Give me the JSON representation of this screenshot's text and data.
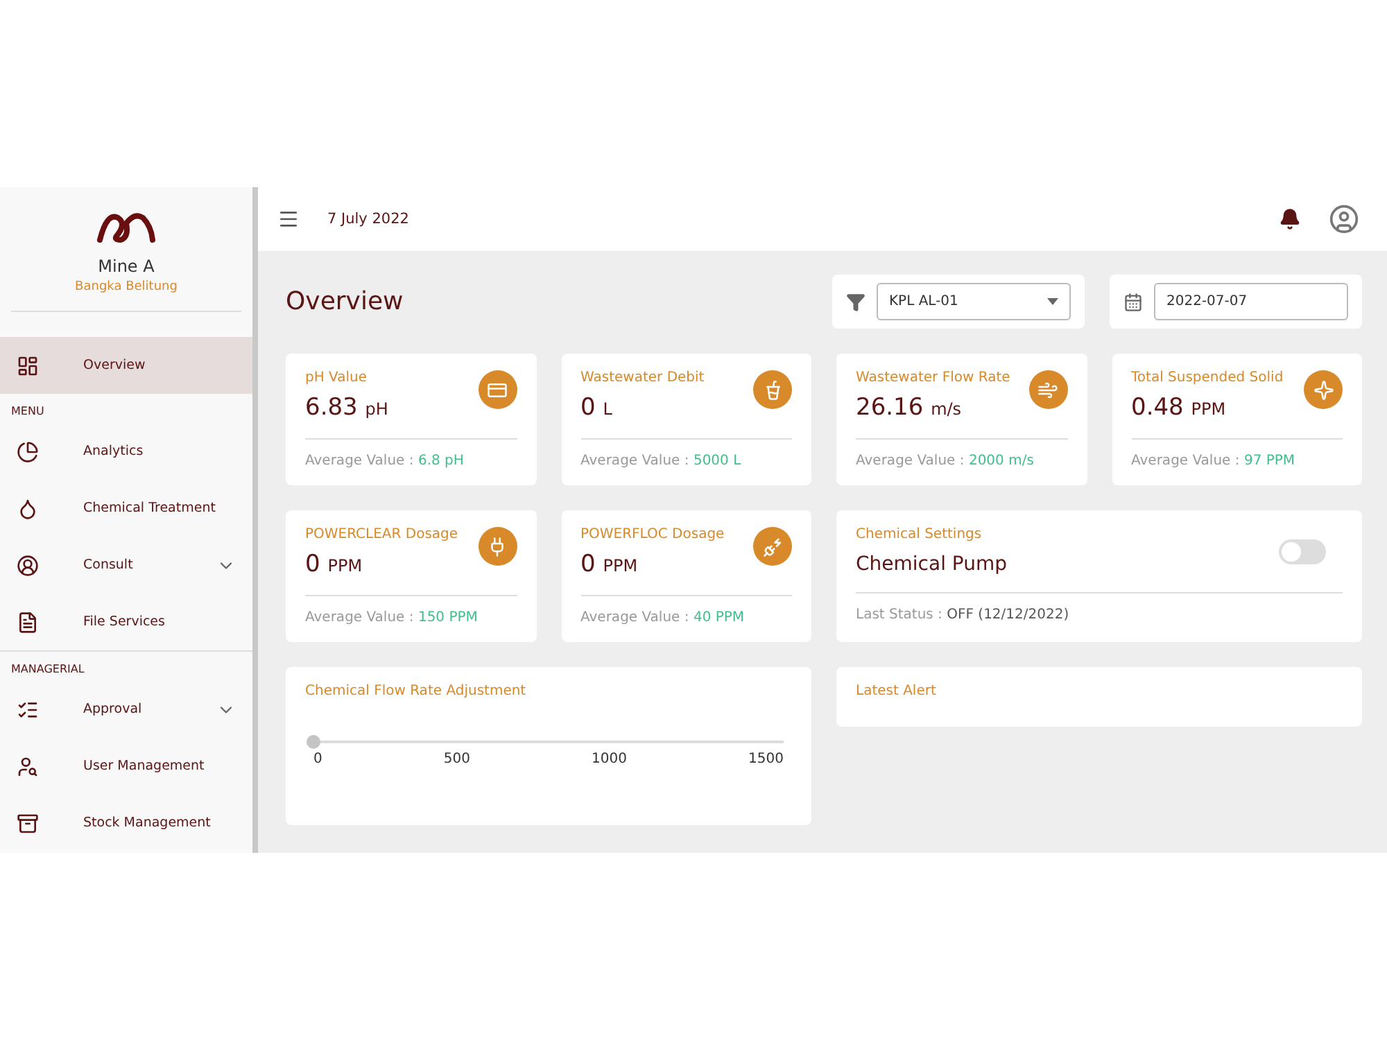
{
  "sidebar": {
    "org_name": "Mine A",
    "org_location": "Bangka Belitung",
    "sections": [
      {
        "items": [
          {
            "label": "Overview",
            "selected": true,
            "expandable": false
          }
        ]
      },
      {
        "header": "MENU",
        "items": [
          {
            "label": "Analytics",
            "selected": false,
            "expandable": false
          },
          {
            "label": "Chemical Treatment",
            "selected": false,
            "expandable": false
          },
          {
            "label": "Consult",
            "selected": false,
            "expandable": true
          },
          {
            "label": "File Services",
            "selected": false,
            "expandable": false
          }
        ]
      },
      {
        "header": "MANAGERIAL",
        "items": [
          {
            "label": "Approval",
            "selected": false,
            "expandable": true
          },
          {
            "label": "User Management",
            "selected": false,
            "expandable": false
          },
          {
            "label": "Stock Management",
            "selected": false,
            "expandable": false
          }
        ]
      }
    ]
  },
  "topbar": {
    "date": "7 July 2022"
  },
  "page_title": "Overview",
  "filter": {
    "value": "KPL AL-01"
  },
  "date_field": {
    "value": "2022-07-07"
  },
  "metrics": [
    {
      "title": "pH Value",
      "value": "6.83",
      "unit": "pH",
      "average_label": "Average Value :",
      "average": "6.8 pH"
    },
    {
      "title": "Wastewater Debit",
      "value": "0",
      "unit": "L",
      "average_label": "Average Value :",
      "average": "5000 L"
    },
    {
      "title": "Wastewater Flow Rate",
      "value": "26.16",
      "unit": "m/s",
      "average_label": "Average Value :",
      "average": "2000 m/s"
    },
    {
      "title": "Total Suspended Solid",
      "value": "0.48",
      "unit": "PPM",
      "average_label": "Average Value :",
      "average": "97 PPM"
    },
    {
      "title": "POWERCLEAR Dosage",
      "value": "0",
      "unit": "PPM",
      "average_label": "Average Value :",
      "average": "150 PPM"
    },
    {
      "title": "POWERFLOC Dosage",
      "value": "0",
      "unit": "PPM",
      "average_label": "Average Value :",
      "average": "40 PPM"
    }
  ],
  "chemical_settings": {
    "title": "Chemical Settings",
    "name": "Chemical Pump",
    "on": false,
    "status_label": "Last Status :",
    "status": "OFF (12/12/2022)"
  },
  "flow_adjustment": {
    "title": "Chemical Flow Rate Adjustment",
    "level": 0,
    "marks": [
      "0",
      "500",
      "1000",
      "1500"
    ]
  },
  "latest_alert": {
    "title": "Latest Alert"
  }
}
